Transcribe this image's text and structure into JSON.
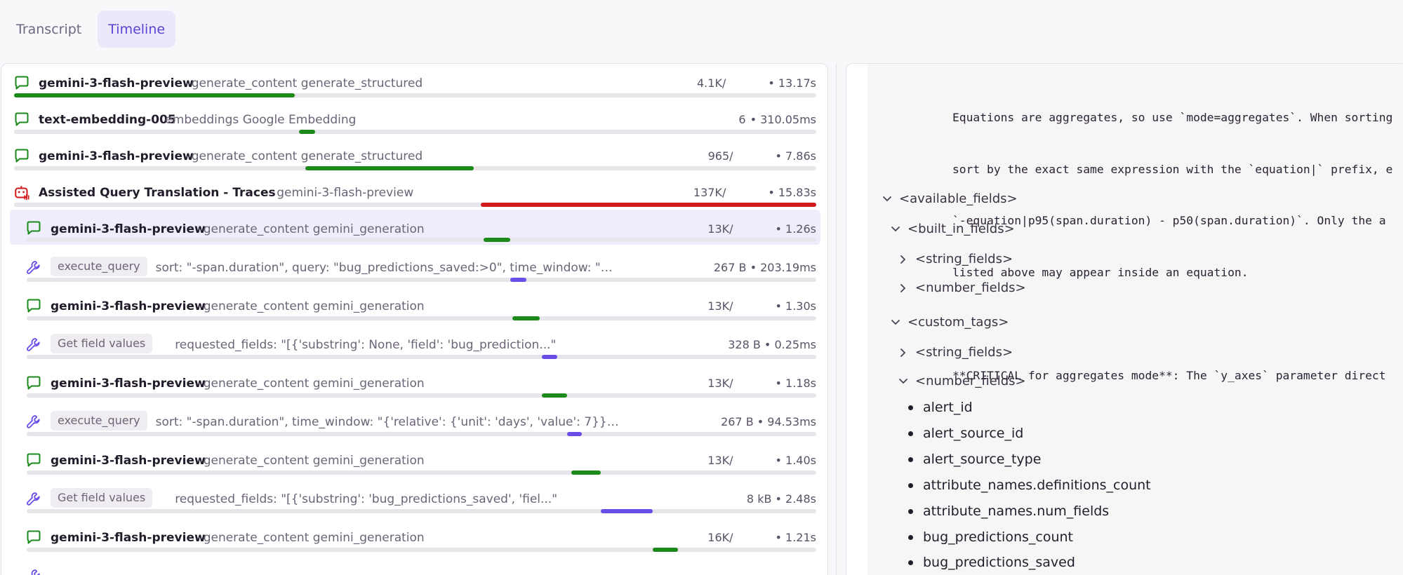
{
  "tabs": [
    {
      "label": "Transcript",
      "active": false
    },
    {
      "label": "Timeline",
      "active": true
    }
  ],
  "colors": {
    "llm": "#1b8a1b",
    "tool": "#6a4ce8",
    "agent": "#d11b1b",
    "track": "#e7e5ea",
    "accent": "#5b43d6"
  },
  "timeline": {
    "rows": [
      {
        "type": "llm",
        "name": "gemini-3-flash-preview",
        "desc": "generate_content generate_structured",
        "tokens": "4.1K/",
        "duration": "• 13.17s",
        "bar_start": 0.0,
        "bar_end": 0.35
      },
      {
        "type": "llm",
        "name": "text-embedding-005",
        "desc": "embeddings Google Embedding",
        "tokens": "6",
        "duration": "• 310.05ms",
        "bar_start": 0.355,
        "bar_end": 0.375
      },
      {
        "type": "llm",
        "name": "gemini-3-flash-preview",
        "desc": "generate_content generate_structured",
        "tokens": "965/",
        "duration": "• 7.86s",
        "bar_start": 0.363,
        "bar_end": 0.573
      },
      {
        "type": "agent",
        "name": "Assisted Query Translation - Traces",
        "desc": "gemini-3-flash-preview",
        "tokens": "137K/",
        "duration": "• 15.83s",
        "bar_start": 0.582,
        "bar_end": 1.0
      },
      {
        "type": "llm",
        "name": "gemini-3-flash-preview",
        "desc": "generate_content gemini_generation",
        "tokens": "13K/",
        "duration": "• 1.26s",
        "bar_start": 0.579,
        "bar_end": 0.612,
        "selected": true
      },
      {
        "type": "tool",
        "tag": "execute_query",
        "desc": "sort: \"-span.duration\", query: \"bug_predictions_saved:>0\", time_window: \"{'relative': {'unit': 'da...",
        "tokens": "267 B",
        "duration": "• 203.19ms",
        "bar_start": 0.612,
        "bar_end": 0.633
      },
      {
        "type": "llm",
        "name": "gemini-3-flash-preview",
        "desc": "generate_content gemini_generation",
        "tokens": "13K/",
        "duration": "• 1.30s",
        "bar_start": 0.615,
        "bar_end": 0.65
      },
      {
        "type": "tool",
        "tag": "Get field values",
        "desc": "requested_fields: \"[{'substring': None, 'field': 'bug_prediction...\"",
        "tokens": "328 B",
        "duration": "• 0.25ms",
        "bar_start": 0.652,
        "bar_end": 0.672
      },
      {
        "type": "llm",
        "name": "gemini-3-flash-preview",
        "desc": "generate_content gemini_generation",
        "tokens": "13K/",
        "duration": "• 1.18s",
        "bar_start": 0.652,
        "bar_end": 0.684
      },
      {
        "type": "tool",
        "tag": "execute_query",
        "desc": "sort: \"-span.duration\", time_window: \"{'relative': {'unit': 'days', 'value': 7}}\", mode: \"spans\", query: \"...",
        "tokens": "267 B",
        "duration": "• 94.53ms",
        "bar_start": 0.684,
        "bar_end": 0.703
      },
      {
        "type": "llm",
        "name": "gemini-3-flash-preview",
        "desc": "generate_content gemini_generation",
        "tokens": "13K/",
        "duration": "• 1.40s",
        "bar_start": 0.69,
        "bar_end": 0.727
      },
      {
        "type": "tool",
        "tag": "Get field values",
        "desc": "requested_fields: \"[{'substring': 'bug_predictions_saved', 'fiel...\"",
        "tokens": "8 kB",
        "duration": "• 2.48s",
        "bar_start": 0.727,
        "bar_end": 0.793
      },
      {
        "type": "llm",
        "name": "gemini-3-flash-preview",
        "desc": "generate_content gemini_generation",
        "tokens": "16K/",
        "duration": "• 1.21s",
        "bar_start": 0.793,
        "bar_end": 0.825
      },
      {
        "type": "tool",
        "tag": "",
        "desc": "",
        "tokens": "",
        "duration": "",
        "bar_start": 0.825,
        "bar_end": 0.84
      }
    ]
  },
  "detail": {
    "code_lines": [
      "Equations are aggregates, so use `mode=aggregates`. When sorting",
      "sort by the exact same expression with the `equation|` prefix, e",
      "`-equation|p95(span.duration) - p50(span.duration)`. Only the a",
      "listed above may appear inside an equation.",
      "",
      "**CRITICAL for aggregates mode**: The `y_axes` parameter direct"
    ],
    "tree": {
      "available_fields": "<available_fields>",
      "built_in_fields": "<built_in_fields>",
      "builtin_string": "<string_fields>",
      "builtin_number": "<number_fields>",
      "custom_tags": "<custom_tags>",
      "custom_string": "<string_fields>",
      "custom_number": "<number_fields>"
    },
    "number_fields": [
      "alert_id",
      "alert_source_id",
      "alert_source_type",
      "attribute_names.definitions_count",
      "attribute_names.num_fields",
      "bug_predictions_count",
      "bug_predictions_saved"
    ]
  }
}
